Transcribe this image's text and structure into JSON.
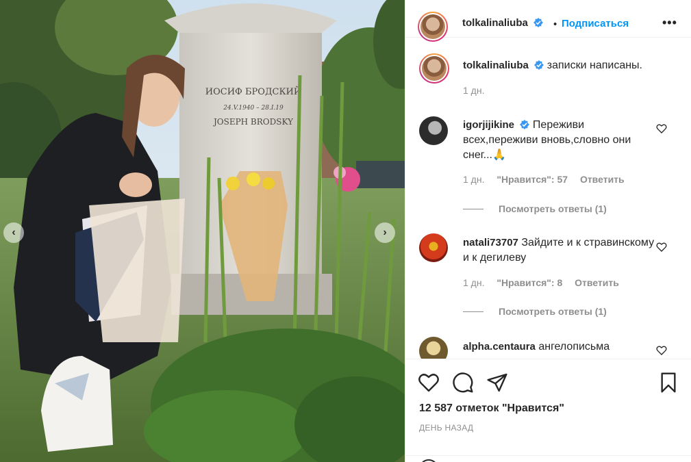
{
  "post": {
    "author": "tolkalinaliuba",
    "follow_label": "Подписаться",
    "more_label": "•••",
    "caption": {
      "username": "tolkalinaliuba",
      "text": "записки написаны.",
      "time": "1 дн."
    },
    "comments": [
      {
        "username": "igorjijikine",
        "verified": true,
        "text": "Переживи всех,переживи вновь,словно они снег...🙏",
        "time": "1 дн.",
        "likes": "\"Нравится\": 57",
        "reply": "Ответить",
        "view_replies": "Посмотреть ответы (1)"
      },
      {
        "username": "natali73707",
        "verified": false,
        "text": "Зайдите и к стравинскому и к дегилеву",
        "time": "1 дн.",
        "likes": "\"Нравится\": 8",
        "reply": "Ответить",
        "view_replies": "Посмотреть ответы (1)"
      },
      {
        "username": "alpha.centaura",
        "verified": false,
        "text": "ангелописьма"
      }
    ],
    "likes_count": "12 587 отметок \"Нравится\"",
    "date_label": "ДЕНЬ НАЗАД"
  },
  "photo": {
    "tombstone_line1": "ИОСИФ БРОДСКИЙ",
    "tombstone_line2": "24.V.1940 – 28.I.19",
    "tombstone_line3": "JOSEPH BRODSKY"
  },
  "colors": {
    "accent_blue": "#0095f6",
    "verified_blue": "#3897f0",
    "text": "#262626",
    "muted": "#8e8e8e",
    "border": "#efefef"
  },
  "icons": {
    "prev": "chevron-left-icon",
    "next": "chevron-right-icon",
    "like": "heart-icon",
    "comment": "comment-icon",
    "share": "paper-plane-icon",
    "save": "bookmark-icon"
  }
}
